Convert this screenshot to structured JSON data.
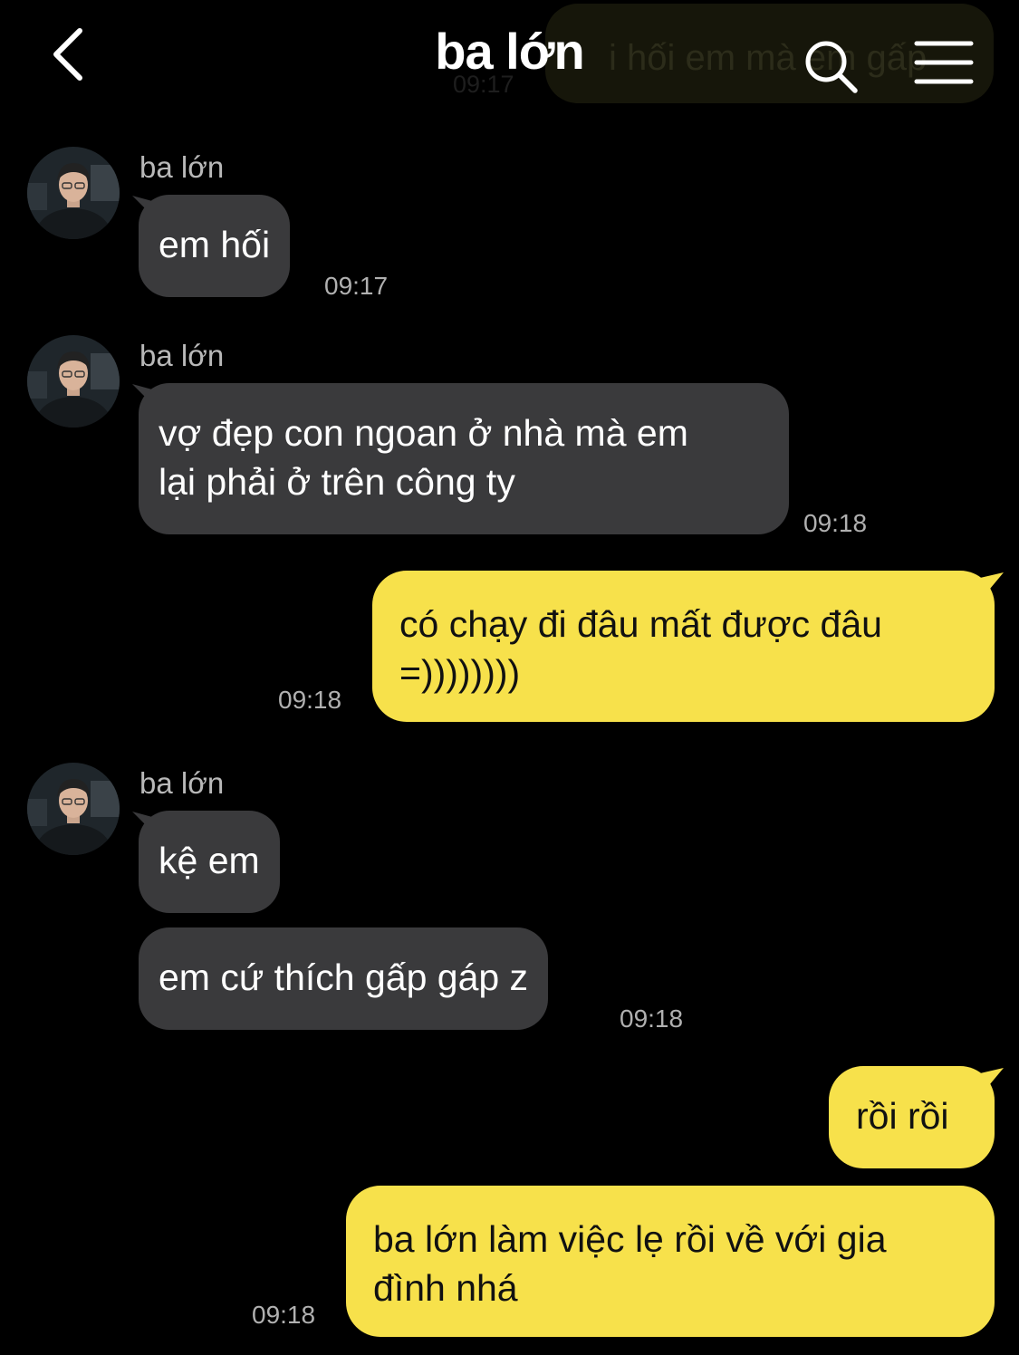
{
  "header": {
    "title": "ba lớn",
    "ghost_text": "i hối em mà em gấp",
    "ghost_time": "09:17",
    "back_icon": "chevron-left-icon",
    "search_icon": "search-icon",
    "menu_icon": "menu-icon"
  },
  "colors": {
    "background": "#000000",
    "incoming_bubble": "#3a3a3c",
    "outgoing_bubble": "#f7e14b",
    "timestamp": "#b0b0b0"
  },
  "messages": [
    {
      "direction": "in",
      "sender": "ba lớn",
      "lines": [
        "em hối"
      ],
      "time": "09:17"
    },
    {
      "direction": "in",
      "sender": "ba lớn",
      "lines": [
        "vợ đẹp con ngoan ở nhà mà em",
        "lại phải ở trên công ty"
      ],
      "time": "09:18"
    },
    {
      "direction": "out",
      "lines": [
        "có chạy đi đâu mất được đâu",
        "=))))))))"
      ],
      "time": "09:18"
    },
    {
      "direction": "in",
      "sender": "ba lớn",
      "lines": [
        "kệ em"
      ]
    },
    {
      "direction": "in",
      "lines": [
        "em cứ thích gấp gáp z"
      ],
      "time": "09:18"
    },
    {
      "direction": "out",
      "lines": [
        "rồi rồi"
      ]
    },
    {
      "direction": "out",
      "lines": [
        "ba lớn làm việc lẹ rồi về với gia",
        "đình nhá"
      ],
      "time": "09:18"
    }
  ]
}
